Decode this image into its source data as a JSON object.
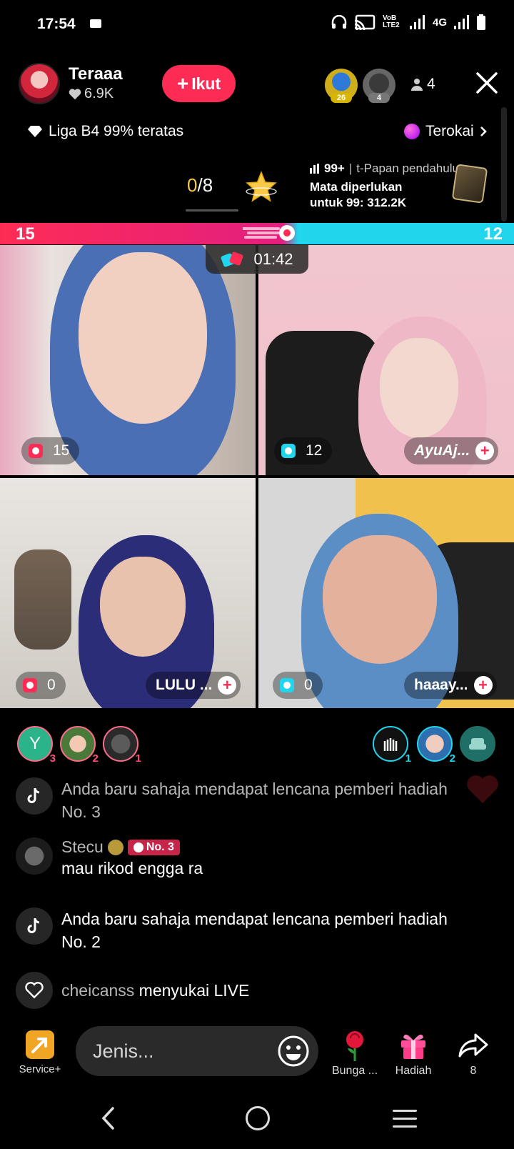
{
  "status_bar": {
    "time": "17:54",
    "network_volte": "VoB LTE2",
    "network_4g": "4G"
  },
  "host": {
    "name": "Teraaa",
    "likes": "6.9K",
    "follow_label": "Ikut"
  },
  "top_viewers": [
    {
      "badge": "26"
    },
    {
      "badge": "4"
    }
  ],
  "viewer_count": "4",
  "league": "Liga B4 99% teratas",
  "explore_label": "Terokai",
  "goal": {
    "current": "0",
    "total": "/8"
  },
  "ranking": {
    "rank": "99+",
    "separator": "|",
    "board": "t-Papan pendahulu",
    "needed_line1": "Mata diperlukan",
    "needed_line2": "untuk 99: 312.2K"
  },
  "battle": {
    "left_score": "15",
    "right_score": "12",
    "timer": "01:42"
  },
  "tiles": [
    {
      "score": "15",
      "name": ""
    },
    {
      "score": "12",
      "name": "AyuAj..."
    },
    {
      "score": "0",
      "name": "LULU ..."
    },
    {
      "score": "0",
      "name": "haaay..."
    }
  ],
  "left_gifters": [
    {
      "initial": "Y",
      "rank": "3"
    },
    {
      "initial": "",
      "rank": "2"
    },
    {
      "initial": "",
      "rank": "1"
    }
  ],
  "right_gifters": [
    {
      "rank": "1"
    },
    {
      "rank": "2"
    },
    {
      "rank": ""
    }
  ],
  "comments": [
    {
      "type": "system",
      "text": "Anda baru sahaja mendapat lencana pemberi hadiah No. 3"
    },
    {
      "type": "user",
      "user": "Stecu",
      "badge": "No. 3",
      "text": "mau rikod engga ra"
    },
    {
      "type": "system",
      "text": "Anda baru sahaja mendapat lencana pemberi hadiah No. 2"
    },
    {
      "type": "like",
      "user": "cheicanss",
      "text": "menyukai LIVE"
    }
  ],
  "bottom_bar": {
    "service_label": "Service+",
    "input_placeholder": "Jenis...",
    "rose_label": "Bunga ...",
    "gift_label": "Hadiah",
    "share_count": "8"
  },
  "colors": {
    "accent_pink": "#fe2c55",
    "accent_cyan": "#20d5ec",
    "gold": "#f7c948"
  },
  "icons": [
    "video-call-icon",
    "headphones-icon",
    "cast-icon",
    "signal-icon",
    "battery-icon",
    "heart-icon",
    "plus-icon",
    "person-icon",
    "close-icon",
    "diamond-icon",
    "ball-icon",
    "chevron-right-icon",
    "star-icon",
    "rank-card-icon",
    "bell-icon",
    "tiktok-icon",
    "emoji-icon",
    "rose-icon",
    "gift-icon",
    "share-icon",
    "back-icon",
    "home-icon",
    "menu-icon"
  ]
}
